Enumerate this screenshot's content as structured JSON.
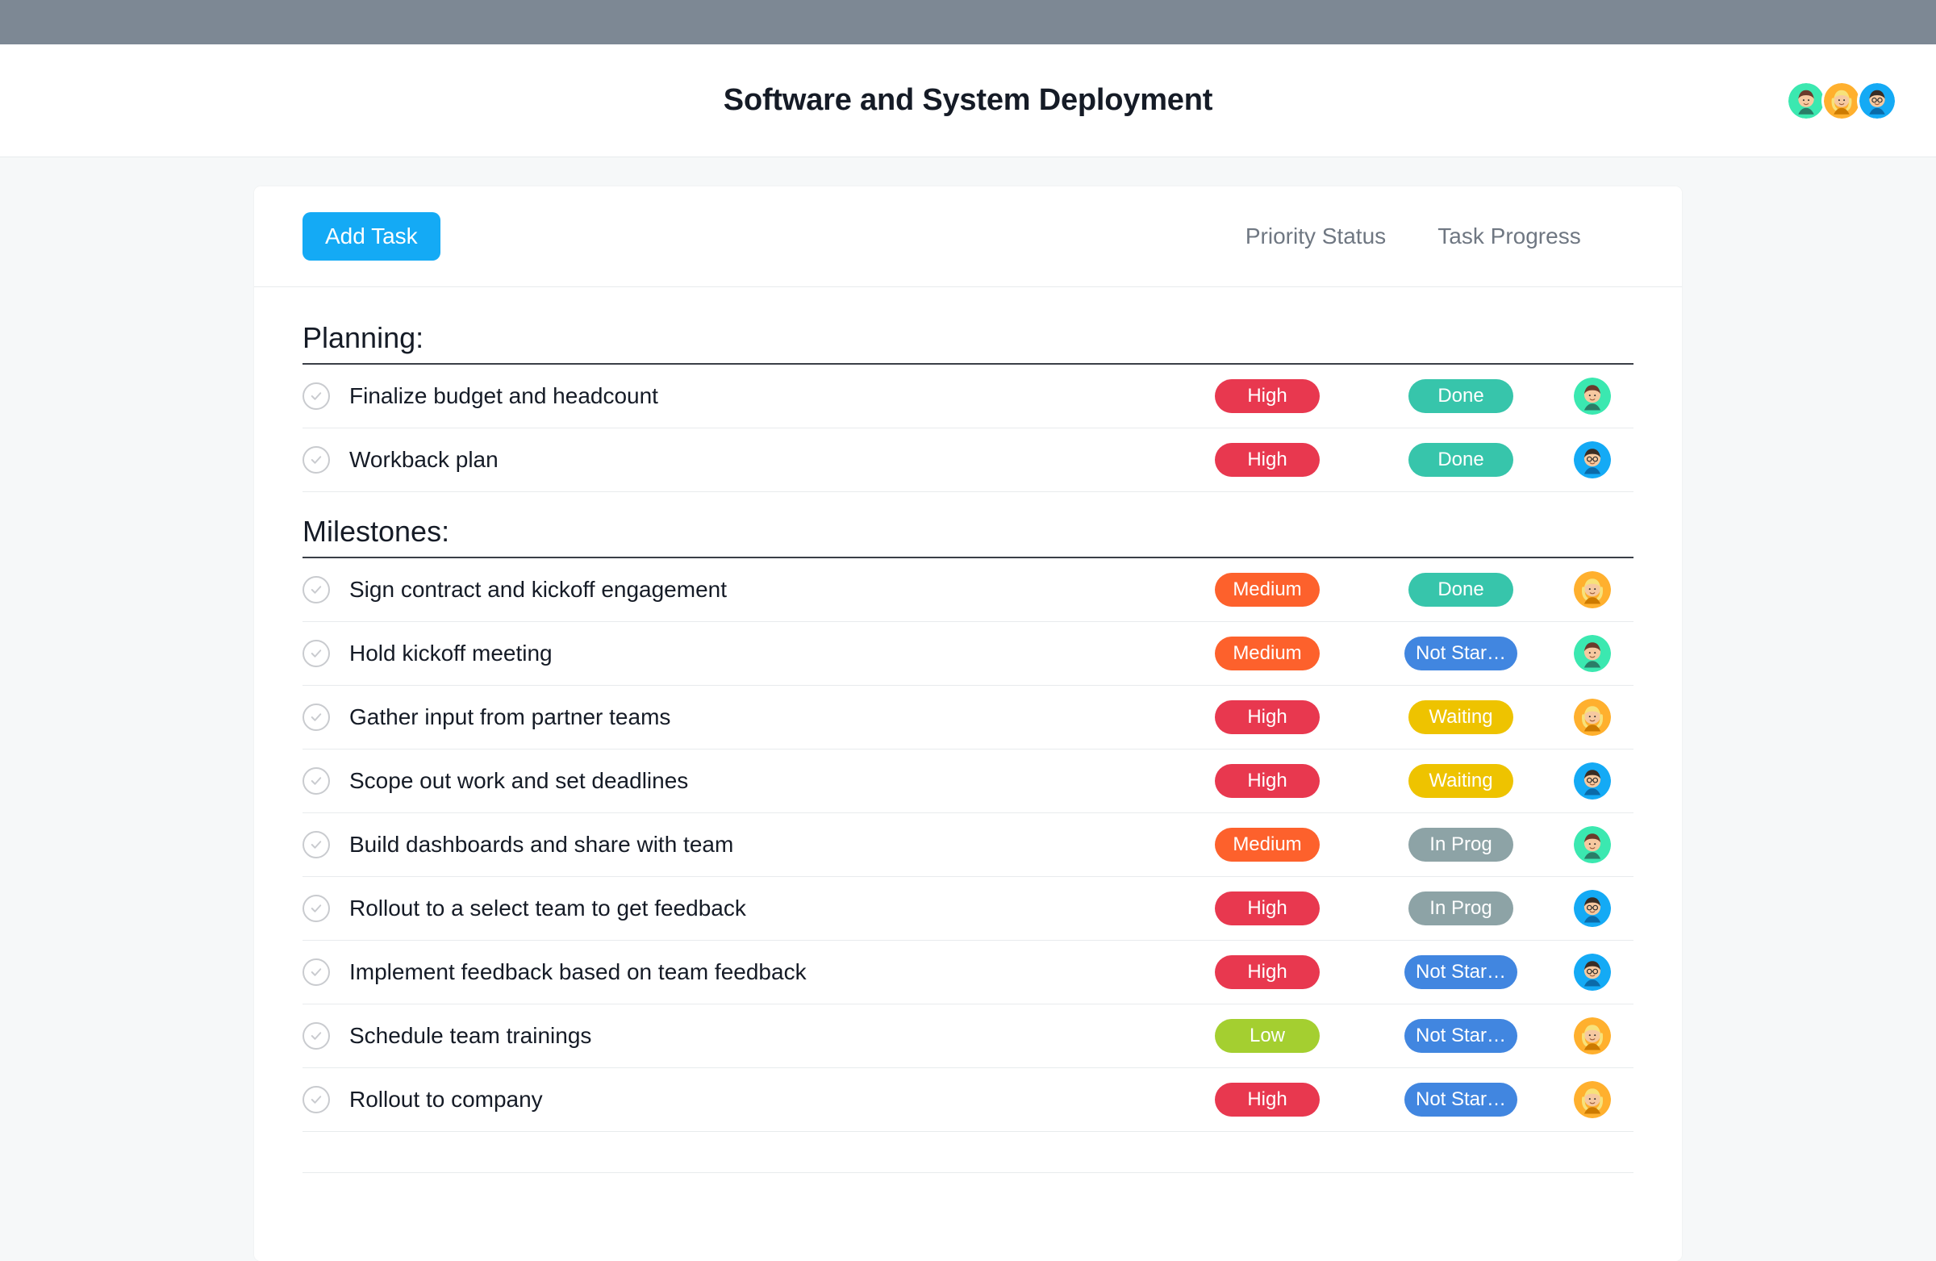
{
  "header": {
    "title": "Software and System Deployment",
    "avatars": [
      "green",
      "orange",
      "blue"
    ]
  },
  "toolbar": {
    "add_task_label": "Add Task",
    "col_priority": "Priority Status",
    "col_progress": "Task Progress"
  },
  "priority_labels": {
    "high": "High",
    "medium": "Medium",
    "low": "Low"
  },
  "progress_labels": {
    "done": "Done",
    "not_started": "Not Star…",
    "waiting": "Waiting",
    "in_prog": "In Prog"
  },
  "colors": {
    "high": "#e8384f",
    "medium": "#fd612c",
    "low": "#a4cf30",
    "done": "#37c5ab",
    "not_started": "#4186e0",
    "waiting": "#eec300",
    "in_prog": "#8da3a6",
    "add_task_btn": "#14aaf5"
  },
  "sections": [
    {
      "title": "Planning:",
      "tasks": [
        {
          "name": "Finalize budget and headcount",
          "priority": "high",
          "progress": "done",
          "assignee": "green"
        },
        {
          "name": "Workback plan",
          "priority": "high",
          "progress": "done",
          "assignee": "blue"
        }
      ]
    },
    {
      "title": "Milestones:",
      "tasks": [
        {
          "name": "Sign contract and kickoff engagement",
          "priority": "medium",
          "progress": "done",
          "assignee": "orange"
        },
        {
          "name": "Hold kickoff meeting",
          "priority": "medium",
          "progress": "not_started",
          "assignee": "green"
        },
        {
          "name": "Gather input from partner teams",
          "priority": "high",
          "progress": "waiting",
          "assignee": "orange"
        },
        {
          "name": "Scope out work and set deadlines",
          "priority": "high",
          "progress": "waiting",
          "assignee": "blue"
        },
        {
          "name": "Build dashboards and share with team",
          "priority": "medium",
          "progress": "in_prog",
          "assignee": "green"
        },
        {
          "name": "Rollout to a select team to get feedback",
          "priority": "high",
          "progress": "in_prog",
          "assignee": "blue"
        },
        {
          "name": "Implement feedback based on team feedback",
          "priority": "high",
          "progress": "not_started",
          "assignee": "blue"
        },
        {
          "name": "Schedule team trainings",
          "priority": "low",
          "progress": "not_started",
          "assignee": "orange"
        },
        {
          "name": "Rollout to company",
          "priority": "high",
          "progress": "not_started",
          "assignee": "orange"
        }
      ]
    }
  ]
}
